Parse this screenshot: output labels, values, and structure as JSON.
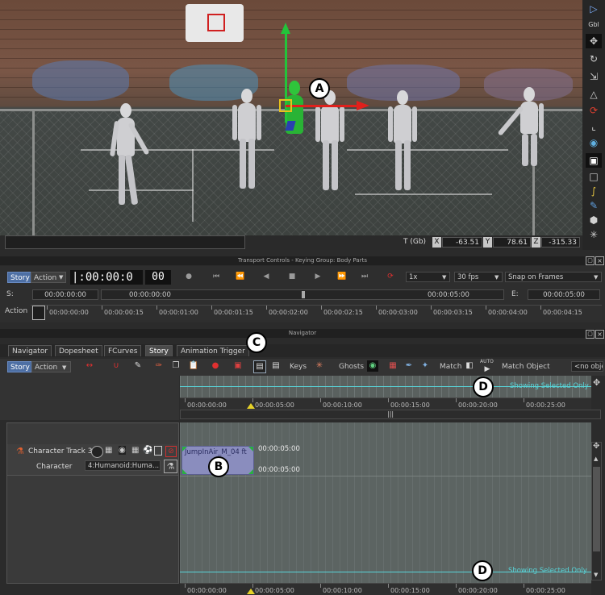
{
  "viewport": {
    "coords": {
      "label": "T (Gb)",
      "x_label": "X",
      "x": "-63.51",
      "y_label": "Y",
      "y": "78.61",
      "z_label": "Z",
      "z": "-315.33"
    }
  },
  "right_toolbar": {
    "gbl_label": "Gbl"
  },
  "transport": {
    "panel_title": "Transport Controls - Keying Group: Body Parts",
    "mode_story": "Story",
    "mode_action": "Action",
    "timecode": "|:00:00:0",
    "frame_display": "00",
    "speed": "1x",
    "fps": "30 fps",
    "snap": "Snap on Frames",
    "start_label": "S:",
    "start_value": "00:00:00:00",
    "current_value": "00:00:00:00",
    "mid_value": "00:00:05:00",
    "end_label": "E:",
    "end_value": "00:00:05:00",
    "action_label": "Action",
    "ruler_ticks": [
      "00:00:00:00",
      "00:00:00:15",
      "00:00:01:00",
      "00:00:01:15",
      "00:00:02:00",
      "00:00:02:15",
      "00:00:03:00",
      "00:00:03:15",
      "00:00:04:00",
      "00:00:04:15"
    ]
  },
  "navigator": {
    "panel_title": "Navigator",
    "tabs": [
      "Navigator",
      "Dopesheet",
      "FCurves",
      "Story",
      "Animation Trigger"
    ],
    "active_tab": "Story",
    "toolbar": {
      "story_btn": "Story",
      "action_btn": "Action",
      "keys_label": "Keys",
      "ghosts_label": "Ghosts",
      "match_label": "Match",
      "auto_label": "AUTO",
      "match_object_label": "Match Object",
      "object_field": "<no obje"
    },
    "ruler_ticks": [
      "00:00:00:00",
      "00:00:05:00",
      "00:00:10:00",
      "00:00:15:00",
      "00:00:20:00",
      "00:00:25:00"
    ],
    "showing_selected_top": "Showing Selected Only",
    "showing_selected_bottom": "Showing Selected Only"
  },
  "track": {
    "name": "Character Track 3",
    "character_label": "Character",
    "character_value": "4:Humanoid:Huma...",
    "clip_name": "JumpInAir_M_04 ft",
    "clip_start": "00:00:05:00",
    "clip_end": "00:00:05:00"
  },
  "callouts": {
    "a": "A",
    "b": "B",
    "c": "C",
    "d_top": "D",
    "d_bottom": "D"
  },
  "colors": {
    "accent": "#4d6fa4",
    "cyan": "#58d4d8",
    "clip": "#7b7fb0",
    "manip_green": "#22c43a",
    "manip_red": "#e0201c"
  }
}
